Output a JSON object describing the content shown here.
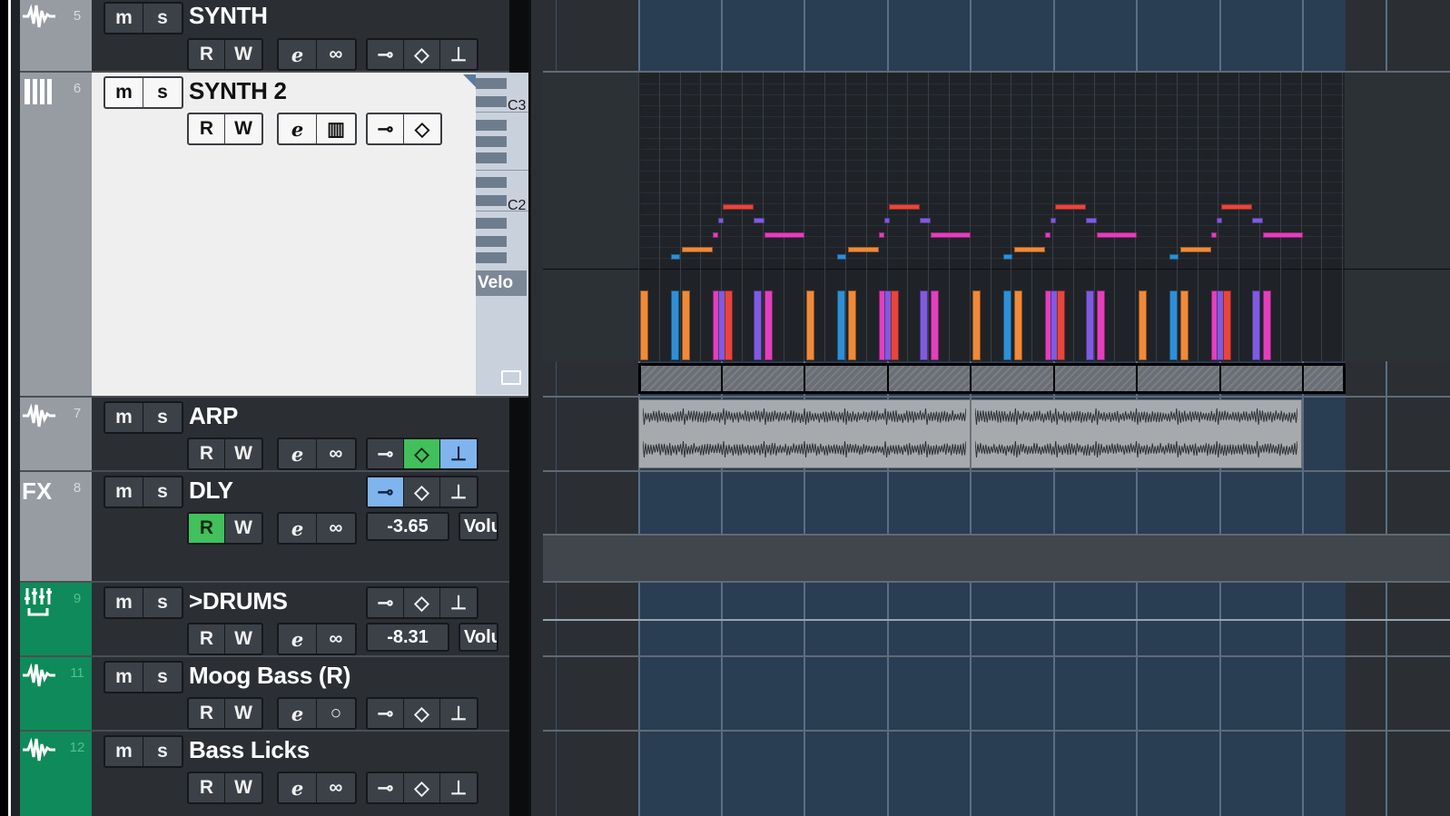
{
  "tracks": [
    {
      "number": "5",
      "name": "SYNTH",
      "type_icon": "audio-waveform-icon",
      "row1": {
        "mute": "m",
        "solo": "s"
      },
      "row2": {
        "read": "R",
        "write": "W",
        "edit_icon": "edit-e-icon",
        "link_icon": "link-icon"
      },
      "inserts": [
        "bypass-icon",
        "compare-icon",
        "eq-icon"
      ]
    },
    {
      "number": "6",
      "name": "SYNTH 2",
      "type_icon": "midi-piano-icon",
      "selected": true,
      "row1": {
        "mute": "m",
        "solo": "s"
      },
      "row2": {
        "read": "R",
        "write": "W",
        "edit_icon": "edit-e-icon",
        "piano_icon": "piano-roll-icon"
      },
      "inserts": [
        "bypass-icon",
        "compare-icon"
      ],
      "keyboard": {
        "label_c3": "C3",
        "label_c2": "C2",
        "lane_tab": "Velo"
      }
    },
    {
      "number": "7",
      "name": "ARP",
      "type_icon": "audio-waveform-icon",
      "row1": {
        "mute": "m",
        "solo": "s"
      },
      "row2": {
        "read": "R",
        "write": "W",
        "edit_icon": "edit-e-icon",
        "link_icon": "link-icon"
      },
      "inserts": [
        "bypass-icon",
        "compare-icon-active-green",
        "eq-icon-active-blue"
      ]
    },
    {
      "number": "8",
      "name": "DLY",
      "type_icon": "FX",
      "row1": {
        "mute": "m",
        "solo": "s"
      },
      "row2": {
        "read": "R",
        "write": "W",
        "edit_icon": "edit-e-icon",
        "link_icon": "link-icon"
      },
      "inserts": [
        "bypass-icon-active-blue",
        "compare-icon",
        "eq-icon"
      ],
      "value": "-3.65",
      "param": "Volu",
      "read_active": true
    },
    {
      "number": "9",
      "name": ">DRUMS",
      "type_icon": "group-mixer-icon",
      "row1": {
        "mute": "m",
        "solo": "s"
      },
      "row2": {
        "read": "R",
        "write": "W",
        "edit_icon": "edit-e-icon",
        "link_icon": "link-icon"
      },
      "inserts": [
        "bypass-icon",
        "compare-icon",
        "eq-icon"
      ],
      "value": "-8.31",
      "param": "Volu"
    },
    {
      "number": "11",
      "name": "Moog Bass (R)",
      "type_icon": "audio-waveform-icon",
      "row1": {
        "mute": "m",
        "solo": "s"
      },
      "row2": {
        "read": "R",
        "write": "W",
        "edit_icon": "edit-e-icon",
        "mono_icon": "mono-circle-icon"
      },
      "inserts": [
        "bypass-icon",
        "compare-icon",
        "eq-icon"
      ]
    },
    {
      "number": "12",
      "name": "Bass Licks",
      "type_icon": "audio-waveform-icon",
      "row1": {
        "mute": "m",
        "solo": "s"
      },
      "row2": {
        "read": "R",
        "write": "W",
        "edit_icon": "edit-e-icon",
        "link_icon": "link-icon"
      },
      "inserts": [
        "bypass-icon",
        "compare-icon",
        "eq-icon"
      ]
    }
  ],
  "colors": {
    "note_orange": "#f08a3a",
    "note_blue": "#2f8fd6",
    "note_purple": "#7f5be0",
    "note_magenta": "#e33fbd",
    "note_red": "#e8453c",
    "group_green": "#0f8a5a",
    "grid_blue": "#293d53"
  }
}
